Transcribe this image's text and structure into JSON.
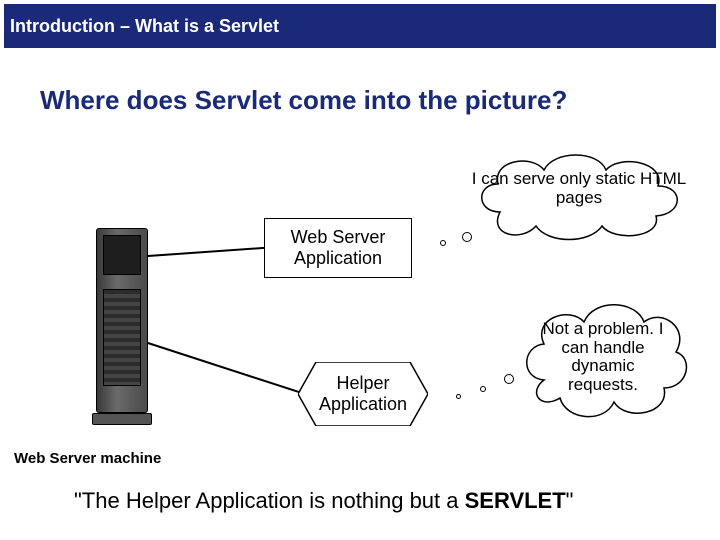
{
  "titlebar": {
    "text": "Introduction – What is a Servlet"
  },
  "heading": "Where does Servlet come into the picture?",
  "boxes": {
    "web_server_app": "Web Server Application",
    "helper_app": "Helper Application"
  },
  "clouds": {
    "static": "I can serve only static HTML pages",
    "dynamic": "Not a problem. I can handle dynamic requests."
  },
  "caption": "Web Server machine",
  "conclusion": {
    "prefix": "\"The Helper Application is nothing but a ",
    "bold": "SERVLET",
    "suffix": "\""
  }
}
